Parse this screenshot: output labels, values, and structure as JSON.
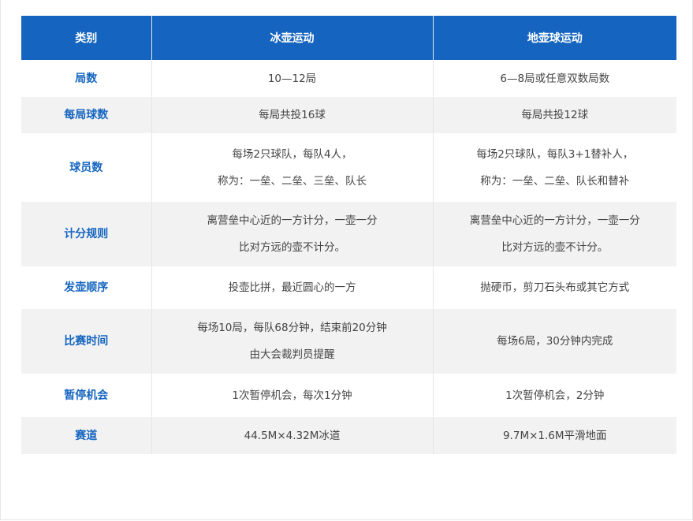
{
  "table": {
    "headers": [
      "类别",
      "冰壶运动",
      "地壶球运动"
    ],
    "rows": [
      {
        "category": "局数",
        "curling": [
          "10—12局"
        ],
        "floorcurling": [
          "6—8局或任意双数局数"
        ]
      },
      {
        "category": "每局球数",
        "curling": [
          "每局共投16球"
        ],
        "floorcurling": [
          "每局共投12球"
        ]
      },
      {
        "category": "球员数",
        "curling": [
          "每场2只球队，每队4人，",
          "称为：一垒、二垒、三垒、队长"
        ],
        "floorcurling": [
          "每场2只球队，每队3+1替补人，",
          "称为：一垒、二垒、队长和替补"
        ]
      },
      {
        "category": "计分规则",
        "curling": [
          "离营垒中心近的一方计分，一壶一分",
          "比对方远的壶不计分。"
        ],
        "floorcurling": [
          "离营垒中心近的一方计分，一壶一分",
          "比对方远的壶不计分。"
        ]
      },
      {
        "category": "发壶顺序",
        "curling": [
          "投壶比拼，最近圆心的一方"
        ],
        "floorcurling": [
          "抛硬币，剪刀石头布或其它方式"
        ]
      },
      {
        "category": "比赛时间",
        "curling": [
          "每场10局，每队68分钟，结束前20分钟",
          "由大会裁判员提醒"
        ],
        "floorcurling": [
          "每场6局，30分钟内完成"
        ]
      },
      {
        "category": "暂停机会",
        "curling": [
          "1次暂停机会，每次1分钟"
        ],
        "floorcurling": [
          "1次暂停机会，2分钟"
        ]
      },
      {
        "category": "赛道",
        "curling": [
          "44.5M×4.32M冰道"
        ],
        "floorcurling": [
          "9.7M×1.6M平滑地面"
        ]
      }
    ]
  },
  "colors": {
    "header_bg": "#1565c0",
    "header_text": "#ffffff",
    "category_text": "#1565c0",
    "alt_row_bg": "#f2f2f2"
  }
}
